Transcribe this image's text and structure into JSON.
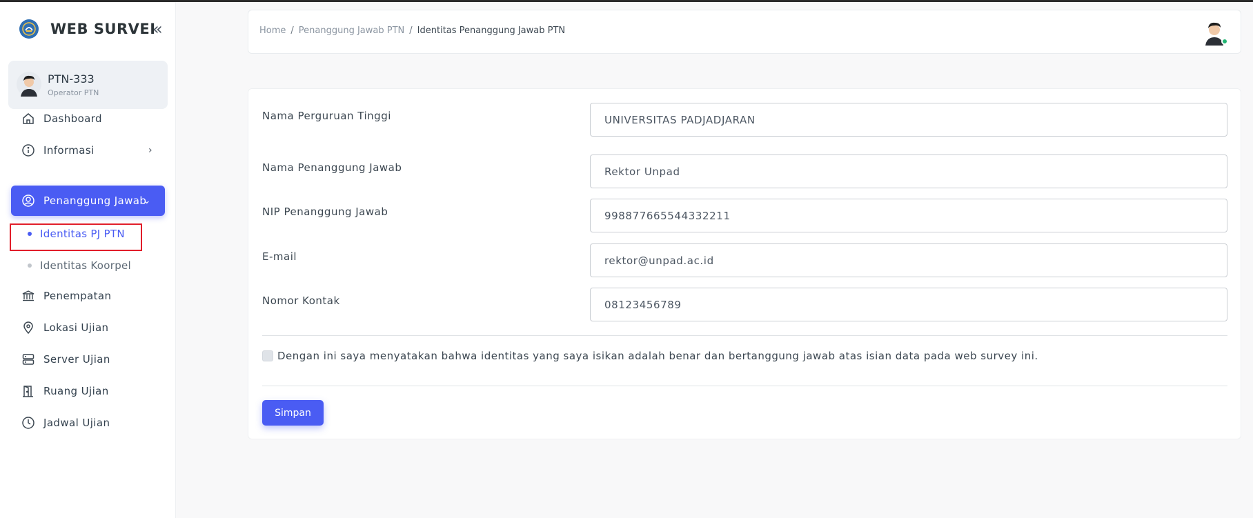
{
  "app": {
    "title": "WEB SURVEI"
  },
  "user": {
    "name": "PTN-333",
    "role": "Operator PTN"
  },
  "sidebar": {
    "items": [
      {
        "label": "Dashboard",
        "icon": "home-icon"
      },
      {
        "label": "Informasi",
        "icon": "info-icon"
      },
      {
        "label": "Penanggung Jawab",
        "icon": "user-circle-icon"
      },
      {
        "label": "Penempatan",
        "icon": "bank-icon"
      },
      {
        "label": "Lokasi Ujian",
        "icon": "map-pin-icon"
      },
      {
        "label": "Server Ujian",
        "icon": "server-icon"
      },
      {
        "label": "Ruang Ujian",
        "icon": "door-icon"
      },
      {
        "label": "Jadwal Ujian",
        "icon": "clock-icon"
      }
    ],
    "sub_items": [
      {
        "label": "Identitas PJ PTN",
        "active": true
      },
      {
        "label": "Identitas Koorpel",
        "active": false
      }
    ]
  },
  "breadcrumb": {
    "home": "Home",
    "parent": "Penanggung Jawab PTN",
    "current": "Identitas Penanggung Jawab PTN",
    "separator": "/"
  },
  "form": {
    "fields": [
      {
        "label": "Nama Perguruan Tinggi",
        "value": "UNIVERSITAS PADJADJARAN"
      },
      {
        "label": "Nama Penanggung Jawab",
        "value": "Rektor Unpad"
      },
      {
        "label": "NIP Penanggung Jawab",
        "value": "998877665544332211"
      },
      {
        "label": "E-mail",
        "value": "rektor@unpad.ac.id"
      },
      {
        "label": "Nomor Kontak",
        "value": "08123456789"
      }
    ],
    "declaration": "Dengan ini saya menyatakan bahwa identitas yang saya isikan adalah benar dan bertanggung jawab atas isian data pada web survey ini.",
    "declaration_checked": false,
    "submit_label": "Simpan"
  },
  "colors": {
    "accent": "#4a5cf3",
    "highlight": "#e11d2a",
    "online": "#22b573"
  }
}
